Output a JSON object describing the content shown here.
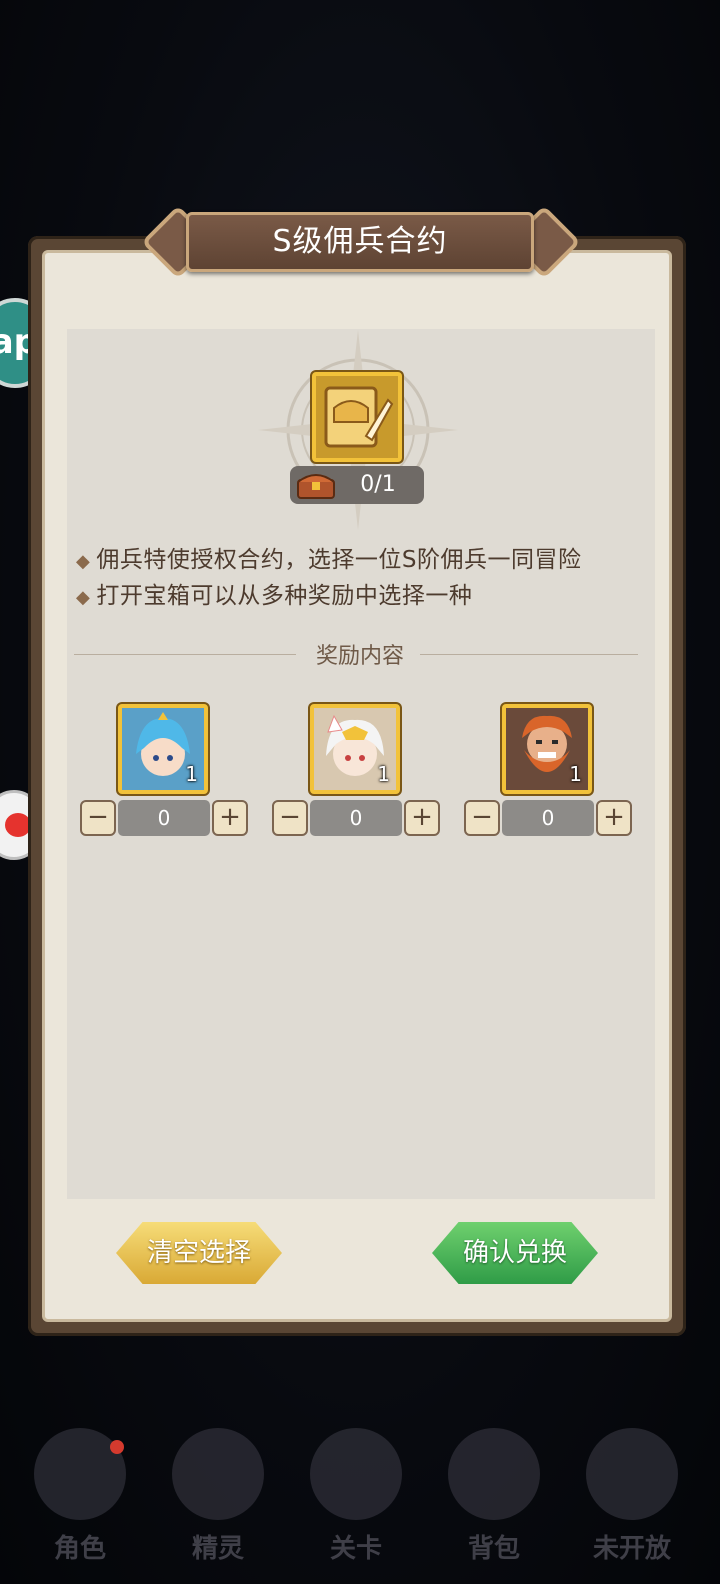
{
  "dialog": {
    "title": "S级佣兵合约",
    "item_count": "0/1",
    "descriptions": [
      "佣兵特使授权合约，选择一位S阶佣兵一同冒险",
      "打开宝箱可以从多种奖励中选择一种"
    ],
    "section_title": "奖励内容",
    "bullet": "◆",
    "rewards": [
      {
        "icon": "blue-hair-elf-hero-icon",
        "quantity": "1",
        "selected": "0"
      },
      {
        "icon": "white-hair-fox-hero-icon",
        "quantity": "1",
        "selected": "0"
      },
      {
        "icon": "orange-beard-dwarf-hero-icon",
        "quantity": "1",
        "selected": "0"
      }
    ],
    "minus": "−",
    "plus": "+",
    "clear_button": "清空选择",
    "confirm_button": "确认兑换"
  },
  "side_buttons": {
    "tap_label": "ap"
  },
  "bottom_nav": {
    "items": [
      {
        "label": "角色",
        "badge": true
      },
      {
        "label": "精灵",
        "badge": false
      },
      {
        "label": "关卡",
        "badge": false
      },
      {
        "label": "背包",
        "badge": false
      },
      {
        "label": "未开放",
        "badge": false
      }
    ]
  },
  "colors": {
    "panel_frame": "#5a4634",
    "paper": "#ebe6da",
    "gold_frame": "#f2c23a",
    "clear_button": "#e6c04f",
    "confirm_button": "#3fae54"
  }
}
